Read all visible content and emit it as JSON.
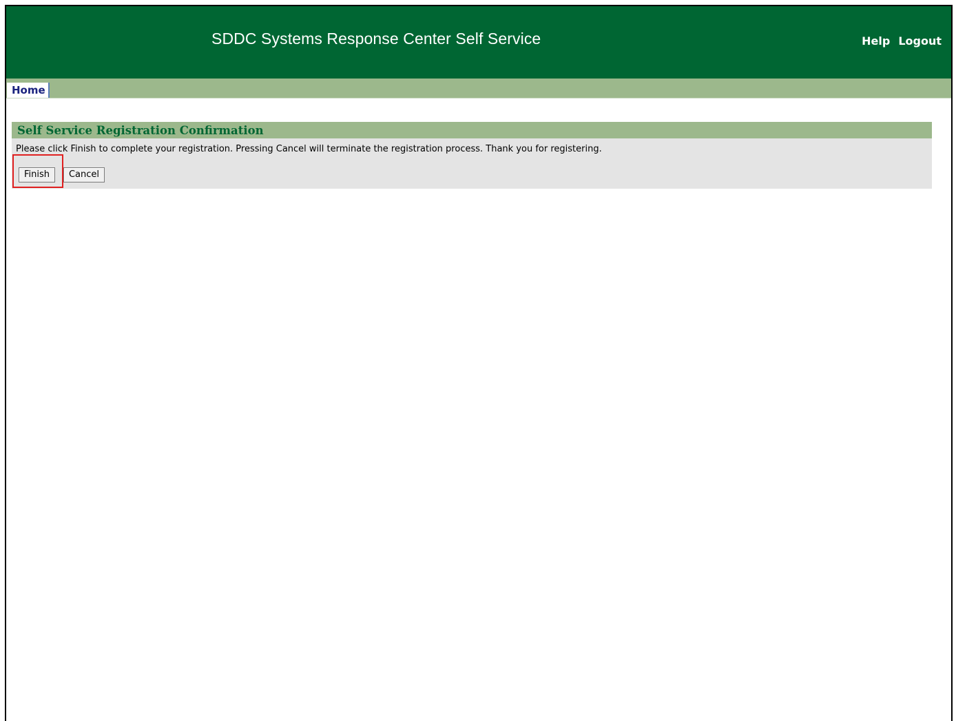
{
  "header": {
    "title": "SDDC Systems Response Center Self Service",
    "links": {
      "help": "Help",
      "logout": "Logout"
    }
  },
  "tabs": {
    "home": "Home"
  },
  "panel": {
    "title": "Self Service Registration Confirmation",
    "message": "Please click Finish to complete your registration. Pressing Cancel will terminate the registration process. Thank you for registering.",
    "buttons": {
      "finish": "Finish",
      "cancel": "Cancel"
    }
  },
  "colors": {
    "header_bg": "#006633",
    "tabbar_bg": "#9cb88c",
    "panel_bg": "#e4e4e4",
    "panel_title": "#006633",
    "highlight": "#e02020"
  }
}
